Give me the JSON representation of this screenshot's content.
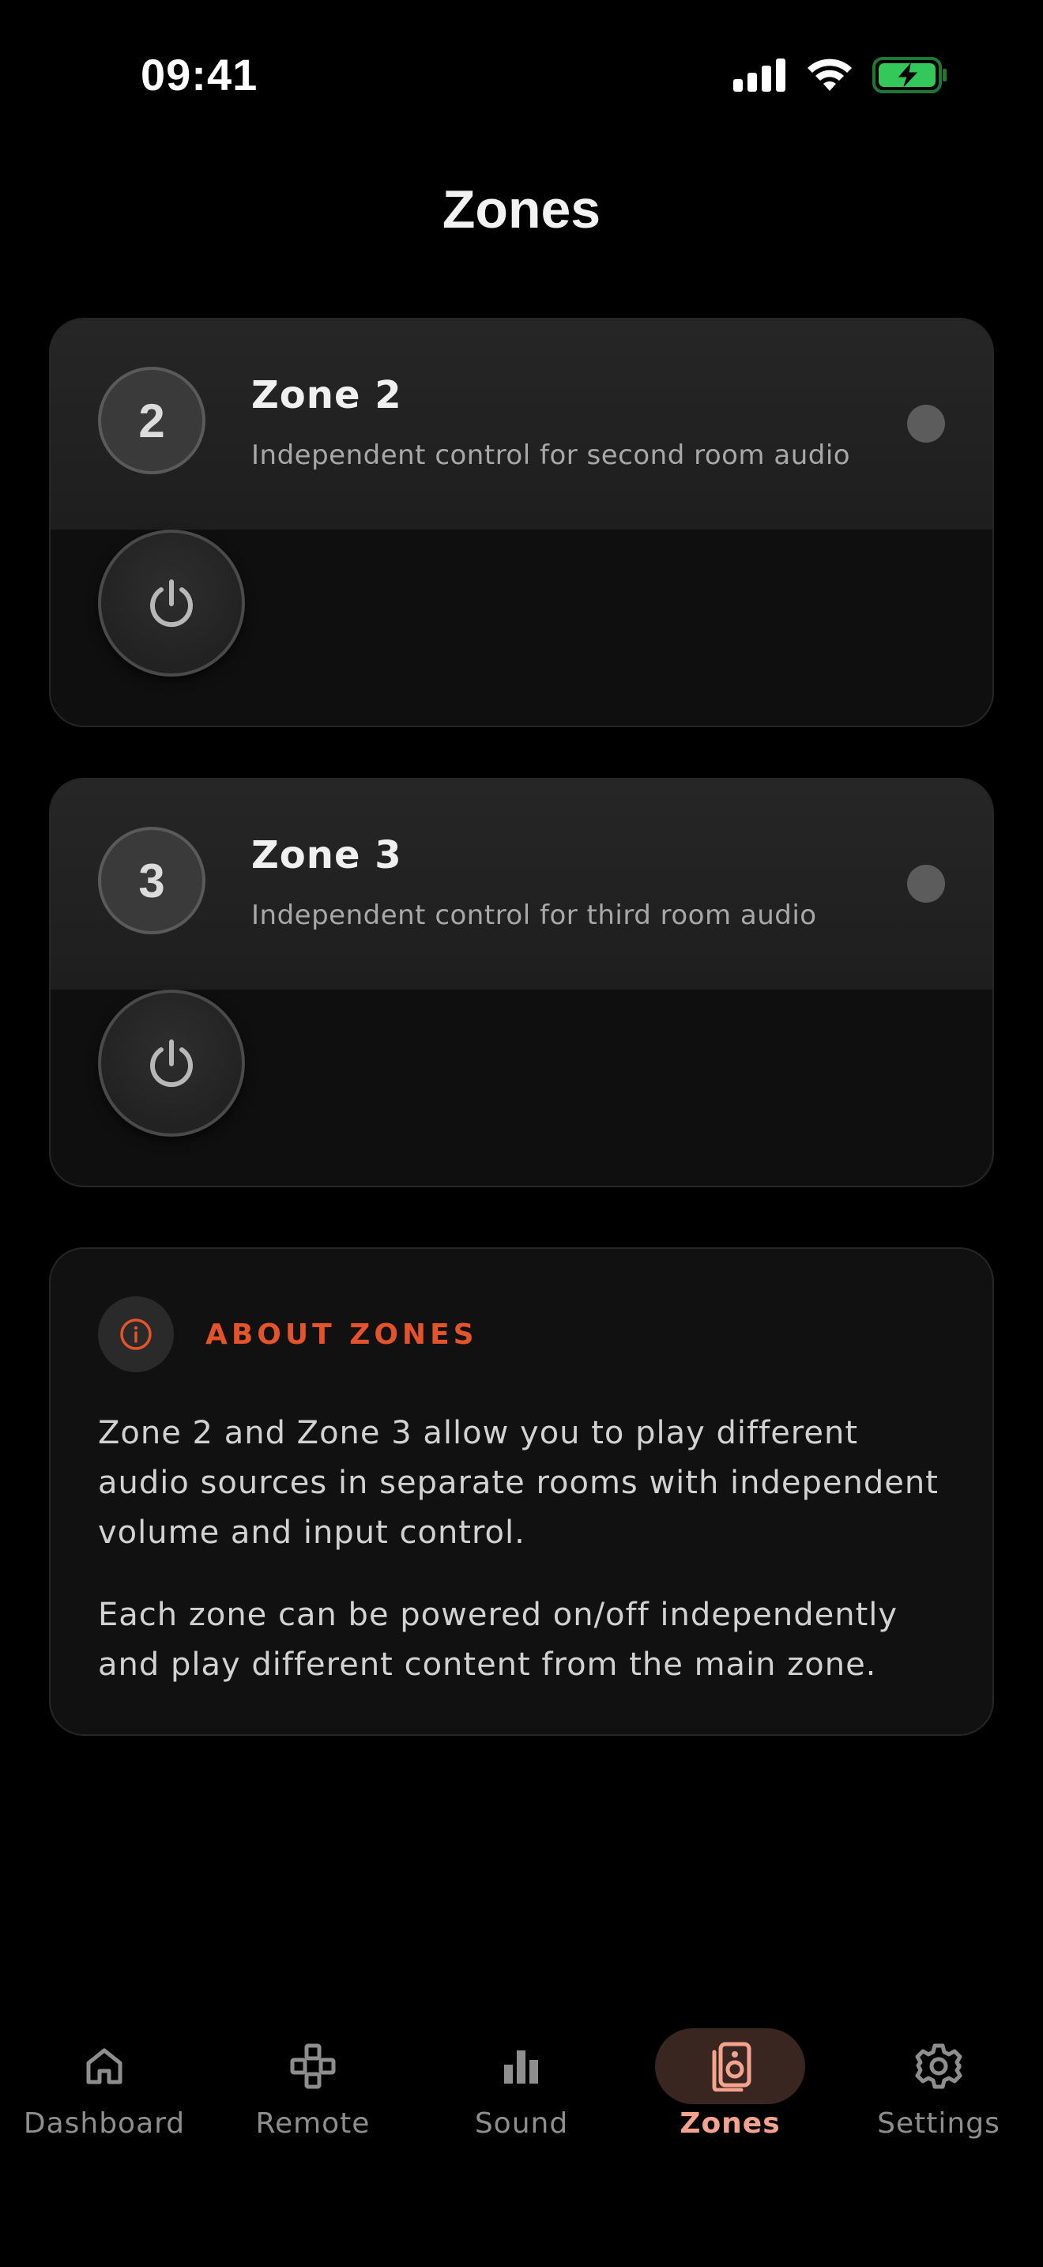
{
  "status_bar": {
    "time": "09:41"
  },
  "page": {
    "title": "Zones"
  },
  "zones": [
    {
      "number": "2",
      "name": "Zone 2",
      "description": "Independent control for second room audio",
      "powered": false
    },
    {
      "number": "3",
      "name": "Zone 3",
      "description": "Independent control for third room audio",
      "powered": false
    }
  ],
  "about": {
    "title": "ABOUT ZONES",
    "paragraph1": "Zone 2 and Zone 3 allow you to play different audio sources in separate rooms with independent volume and input control.",
    "paragraph2": "Each zone can be powered on/off independently and play different content from the main zone."
  },
  "nav": {
    "items": [
      {
        "label": "Dashboard",
        "icon": "home-icon",
        "active": false
      },
      {
        "label": "Remote",
        "icon": "gamepad-icon",
        "active": false
      },
      {
        "label": "Sound",
        "icon": "bar-chart-icon",
        "active": false
      },
      {
        "label": "Zones",
        "icon": "speaker-icon",
        "active": true
      },
      {
        "label": "Settings",
        "icon": "gear-icon",
        "active": false
      }
    ]
  },
  "colors": {
    "accent": "#e4532a",
    "accent_light": "#f5a38e",
    "battery_green": "#34c759"
  }
}
